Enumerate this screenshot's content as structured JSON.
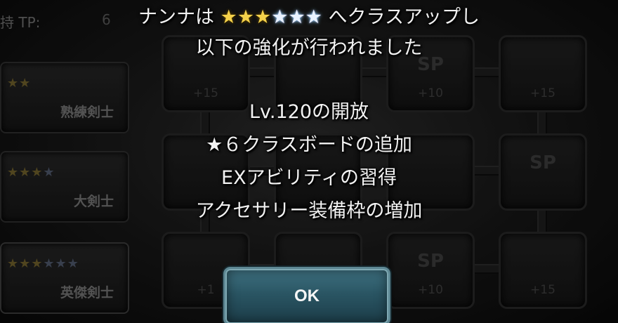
{
  "colors": {
    "gold_star": "#f4d14a",
    "rainbow_star": "#e9f2ff",
    "button": "#2a5563"
  },
  "sidebar": {
    "tp_label": "持 TP:",
    "tp_value": "6",
    "classes": [
      {
        "stars_gold": "★★",
        "stars_blue": "",
        "name": "熟練剣士"
      },
      {
        "stars_gold": "★★★",
        "stars_blue": "★",
        "name": "大剣士"
      },
      {
        "stars_gold": "★★★",
        "stars_blue": "★★★",
        "name": "英傑剣士"
      }
    ]
  },
  "board": {
    "nodes": [
      {
        "symbol": "",
        "bonus": "+15"
      },
      {
        "symbol": "",
        "bonus": ""
      },
      {
        "symbol": "SP",
        "bonus": "+10"
      },
      {
        "symbol": "",
        "bonus": "+15"
      },
      {
        "symbol": "",
        "bonus": ""
      },
      {
        "symbol": "",
        "bonus": ""
      },
      {
        "symbol": "",
        "bonus": ""
      },
      {
        "symbol": "SP",
        "bonus": ""
      },
      {
        "symbol": "",
        "bonus": "+1"
      },
      {
        "symbol": "",
        "bonus": ""
      },
      {
        "symbol": "SP",
        "bonus": "+10"
      },
      {
        "symbol": "",
        "bonus": "+15"
      }
    ]
  },
  "dialog": {
    "line1_prefix": "ナンナは",
    "stars_gold": "★★★",
    "stars_rainbow": "★★★",
    "line1_suffix": "へクラスアップし",
    "line2": "以下の強化が行われました",
    "upgrades": [
      "Lv.120の開放",
      "★６クラスボードの追加",
      "EXアビリティの習得",
      "アクセサリー装備枠の増加"
    ],
    "ok_label": "OK"
  }
}
